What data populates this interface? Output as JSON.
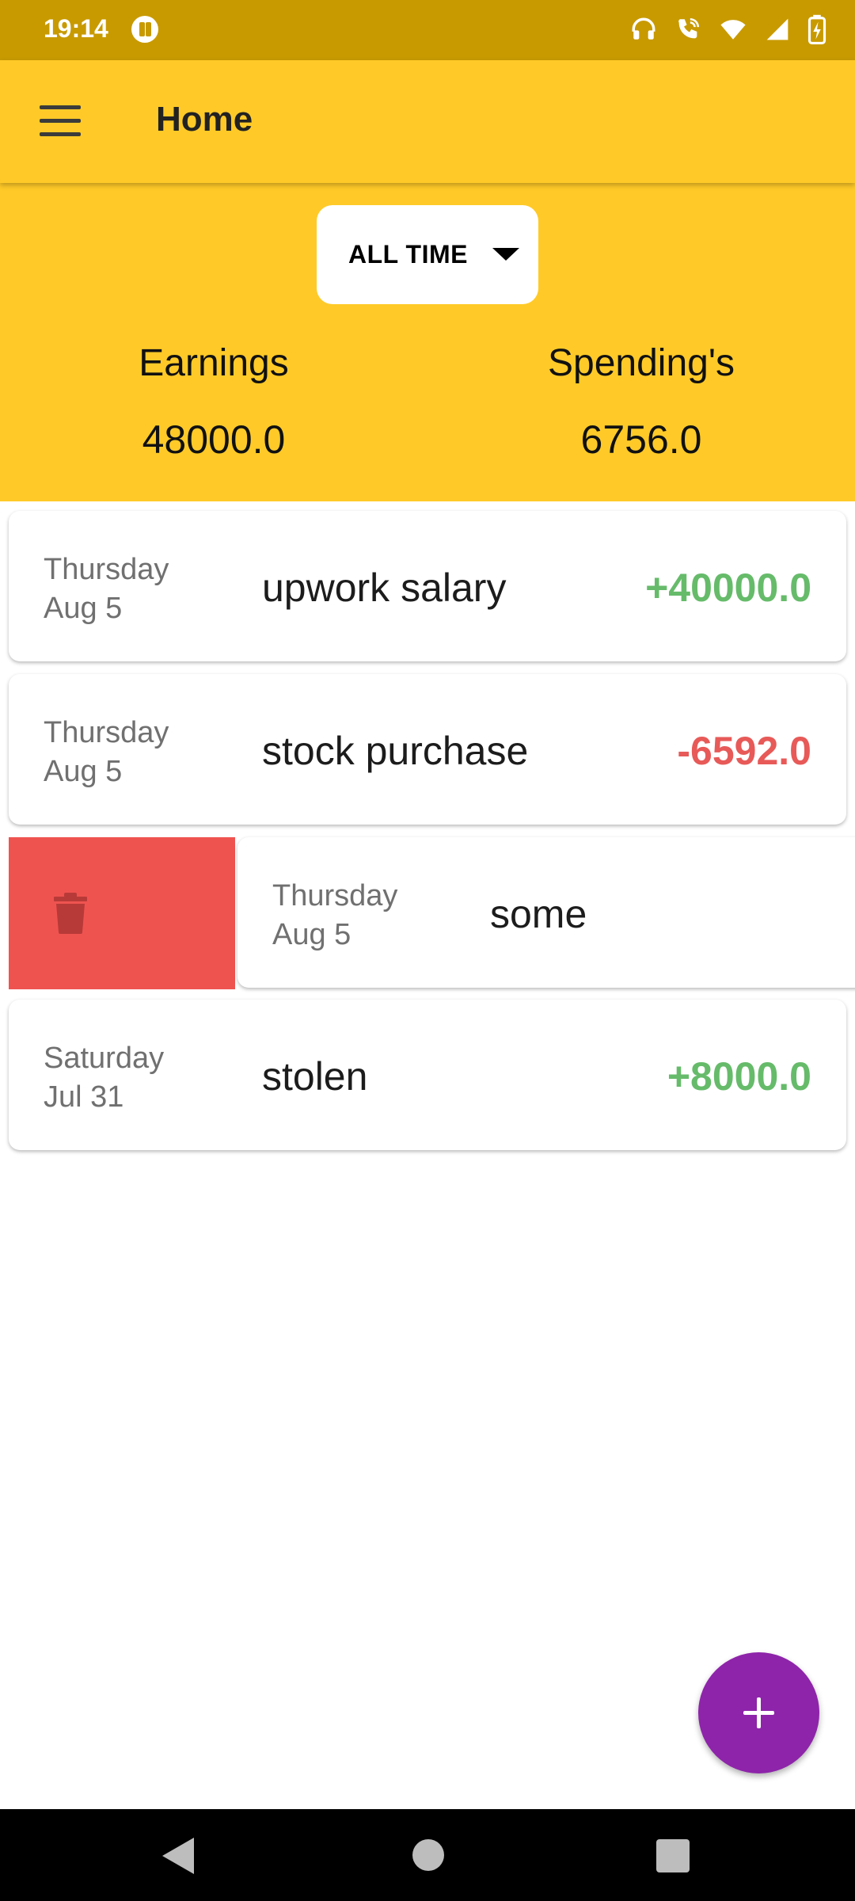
{
  "status_bar": {
    "time": "19:14"
  },
  "app_bar": {
    "title": "Home"
  },
  "summary": {
    "period": "ALL TIME",
    "earnings_label": "Earnings",
    "earnings_value": "48000.0",
    "spendings_label": "Spending's",
    "spendings_value": "6756.0"
  },
  "transactions": [
    {
      "day": "Thursday",
      "date": "Aug 5",
      "description": "upwork salary",
      "amount": "+40000.0"
    },
    {
      "day": "Thursday",
      "date": "Aug 5",
      "description": "stock purchase",
      "amount": "-6592.0"
    },
    {
      "day": "Thursday",
      "date": "Aug 5",
      "description": "some",
      "amount": ""
    },
    {
      "day": "Saturday",
      "date": "Jul 31",
      "description": "stolen",
      "amount": "+8000.0"
    }
  ],
  "colors": {
    "primary": "#FFCA28",
    "status_bar": "#C89A00",
    "positive": "#66BB6A",
    "negative": "#E75A58",
    "delete": "#EF5350",
    "fab": "#8E24AA"
  },
  "icons": [
    "menu-icon",
    "caret-down-icon",
    "trash-icon",
    "plus-icon",
    "headphones-icon",
    "wifi-calling-icon",
    "wifi-icon",
    "signal-icon",
    "battery-charging-icon"
  ]
}
